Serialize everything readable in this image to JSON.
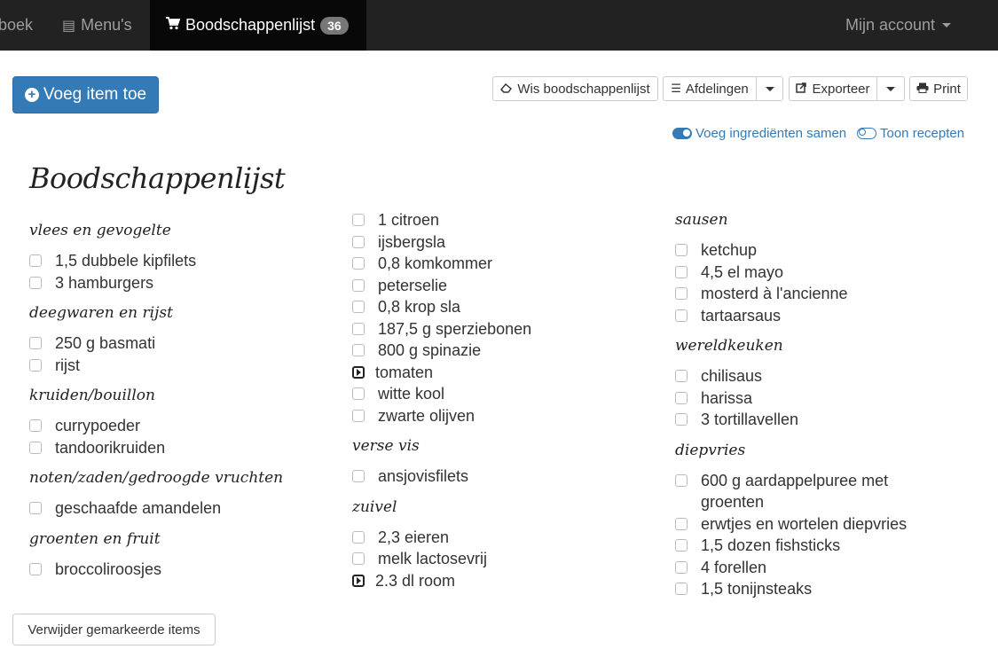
{
  "navbar": {
    "partial_item": "boek",
    "menus": {
      "icon": "list-alt-icon",
      "label": "Menu's"
    },
    "shopping": {
      "icon": "shopping-cart-icon",
      "label": "Boodschappenlijst",
      "badge": "36"
    },
    "account": {
      "label": "Mijn account"
    }
  },
  "toolbar": {
    "add_item": "Voeg item toe",
    "clear": "Wis boodschappenlijst",
    "departments": "Afdelingen",
    "export": "Exporteer",
    "print": "Print"
  },
  "toggles": {
    "merge": "Voeg ingrediënten samen",
    "recipes": "Toon recepten"
  },
  "page_title": "Boodschappenlijst",
  "columns": [
    {
      "sections": [
        {
          "heading": "vlees en gevogelte",
          "items": [
            {
              "text": "1,5 dubbele kipfilets",
              "marked": false
            },
            {
              "text": "3 hamburgers",
              "marked": false
            }
          ]
        },
        {
          "heading": "deegwaren en rijst",
          "items": [
            {
              "text": "250 g basmati",
              "marked": false
            },
            {
              "text": "rijst",
              "marked": false
            }
          ]
        },
        {
          "heading": "kruiden/bouillon",
          "items": [
            {
              "text": "currypoeder",
              "marked": false
            },
            {
              "text": "tandoorikruiden",
              "marked": false
            }
          ]
        },
        {
          "heading": "noten/zaden/gedroogde vruchten",
          "items": [
            {
              "text": "geschaafde amandelen",
              "marked": false
            }
          ]
        },
        {
          "heading": "groenten en fruit",
          "items": [
            {
              "text": "broccoliroosjes",
              "marked": false
            }
          ]
        }
      ]
    },
    {
      "sections": [
        {
          "heading": "",
          "items": [
            {
              "text": "1 citroen",
              "marked": false
            },
            {
              "text": "ijsbergsla",
              "marked": false
            },
            {
              "text": "0,8 komkommer",
              "marked": false
            },
            {
              "text": "peterselie",
              "marked": false
            },
            {
              "text": "0,8 krop sla",
              "marked": false
            },
            {
              "text": "187,5 g sperziebonen",
              "marked": false
            },
            {
              "text": "800 g spinazie",
              "marked": false
            },
            {
              "text": "tomaten",
              "marked": true
            },
            {
              "text": "witte kool",
              "marked": false
            },
            {
              "text": "zwarte olijven",
              "marked": false
            }
          ]
        },
        {
          "heading": "verse vis",
          "items": [
            {
              "text": "ansjovisfilets",
              "marked": false
            }
          ]
        },
        {
          "heading": "zuivel",
          "items": [
            {
              "text": "2,3 eieren",
              "marked": false
            },
            {
              "text": "melk lactosevrij",
              "marked": false
            },
            {
              "text": "2.3 dl room",
              "marked": true
            }
          ]
        }
      ]
    },
    {
      "sections": [
        {
          "heading": "sausen",
          "items": [
            {
              "text": "ketchup",
              "marked": false
            },
            {
              "text": "4,5 el mayo",
              "marked": false
            },
            {
              "text": "mosterd à l'ancienne",
              "marked": false
            },
            {
              "text": "tartaarsaus",
              "marked": false
            }
          ]
        },
        {
          "heading": "wereldkeuken",
          "items": [
            {
              "text": "chilisaus",
              "marked": false
            },
            {
              "text": "harissa",
              "marked": false
            },
            {
              "text": "3 tortillavellen",
              "marked": false
            }
          ]
        },
        {
          "heading": "diepvries",
          "items": [
            {
              "text": "600 g aardappelpuree met groenten",
              "marked": false
            },
            {
              "text": "erwtjes en wortelen diepvries",
              "marked": false
            },
            {
              "text": "1,5 dozen fishsticks",
              "marked": false
            },
            {
              "text": "4 forellen",
              "marked": false
            },
            {
              "text": "1,5 tonijnsteaks",
              "marked": false
            }
          ]
        }
      ]
    }
  ],
  "remove_marked": "Verwijder gemarkeerde items",
  "colors": {
    "navbar": "#222222",
    "primary": "#337ab7",
    "active_nav": "#080808"
  }
}
